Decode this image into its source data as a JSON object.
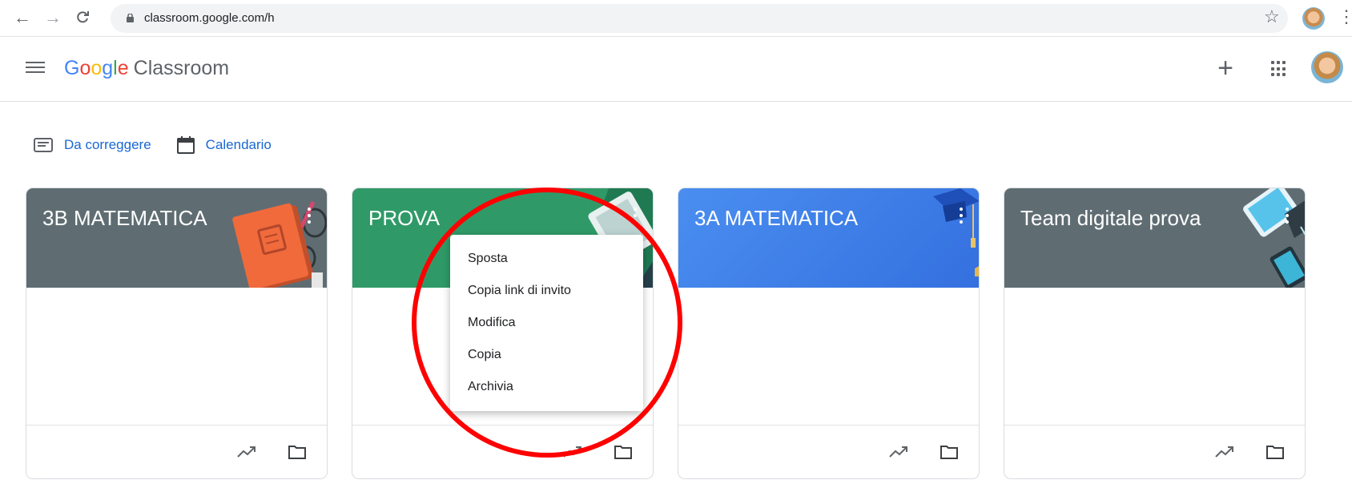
{
  "browser": {
    "url": "classroom.google.com/h",
    "back_icon": "arrow-left-icon",
    "forward_icon": "arrow-right-icon",
    "reload_icon": "reload-icon",
    "star_icon": "star-icon",
    "menu_icon": "three-dot-menu-icon"
  },
  "header": {
    "logo_parts": [
      "G",
      "o",
      "o",
      "g",
      "l",
      "e"
    ],
    "app_name": "Classroom",
    "add_label": "+"
  },
  "quick_links": [
    {
      "label": "Da correggere",
      "icon": "to-review-icon"
    },
    {
      "label": "Calendario",
      "icon": "calendar-icon"
    }
  ],
  "cards": [
    {
      "title": "3B MATEMATICA",
      "color": "#5f6d73"
    },
    {
      "title": "PROVA",
      "color": "#2f9a68"
    },
    {
      "title": "3A MATEMATICA",
      "color": "#3d7ee5"
    },
    {
      "title": "Team digitale prova",
      "color": "#5f6d73"
    }
  ],
  "dropdown": {
    "items": [
      "Sposta",
      "Copia link di invito",
      "Modifica",
      "Copia",
      "Archivia"
    ]
  },
  "colors": {
    "link_blue": "#1967d2",
    "annotation_red": "#ff0000"
  }
}
